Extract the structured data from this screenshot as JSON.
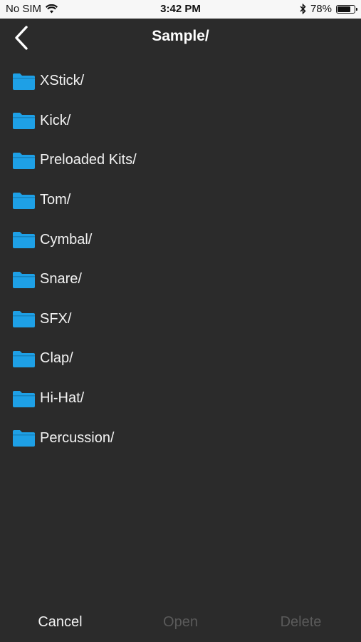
{
  "status_bar": {
    "carrier": "No SIM",
    "time": "3:42 PM",
    "battery_percent": "78%",
    "battery_level": 0.78,
    "icons": [
      "wifi-icon",
      "bluetooth-icon",
      "battery-icon"
    ]
  },
  "nav": {
    "title": "Sample/",
    "back_icon": "chevron-left-icon"
  },
  "folders": [
    {
      "label": "XStick/"
    },
    {
      "label": "Kick/"
    },
    {
      "label": "Preloaded Kits/"
    },
    {
      "label": "Tom/"
    },
    {
      "label": "Cymbal/"
    },
    {
      "label": "Snare/"
    },
    {
      "label": "SFX/"
    },
    {
      "label": "Clap/"
    },
    {
      "label": "Hi-Hat/"
    },
    {
      "label": "Percussion/"
    }
  ],
  "bottom_bar": {
    "cancel_label": "Cancel",
    "open_label": "Open",
    "delete_label": "Delete"
  },
  "colors": {
    "background": "#2b2b2b",
    "folder_blue": "#1ea0e6",
    "text": "#f2f2f2",
    "disabled_text": "#5a5a5a"
  }
}
